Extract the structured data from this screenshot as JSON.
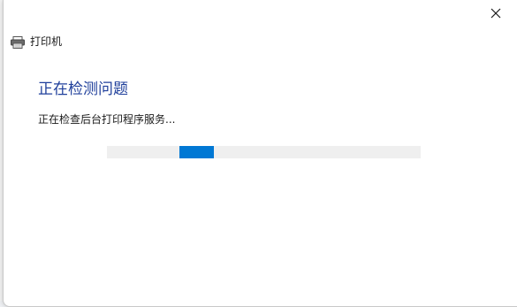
{
  "window": {
    "title": "打印机",
    "close_glyph": "✕",
    "title_icon": "printer-icon",
    "close_icon": "close-icon"
  },
  "content": {
    "heading": "正在检测问题",
    "status_text": "正在检查后台打印程序服务..."
  },
  "progress": {
    "indeterminate": true,
    "value_fraction": 0.23,
    "track_color": "#efefef",
    "fill_color": "#0078d4"
  },
  "colors": {
    "heading": "#1f3f9b",
    "accent": "#0078d4"
  }
}
